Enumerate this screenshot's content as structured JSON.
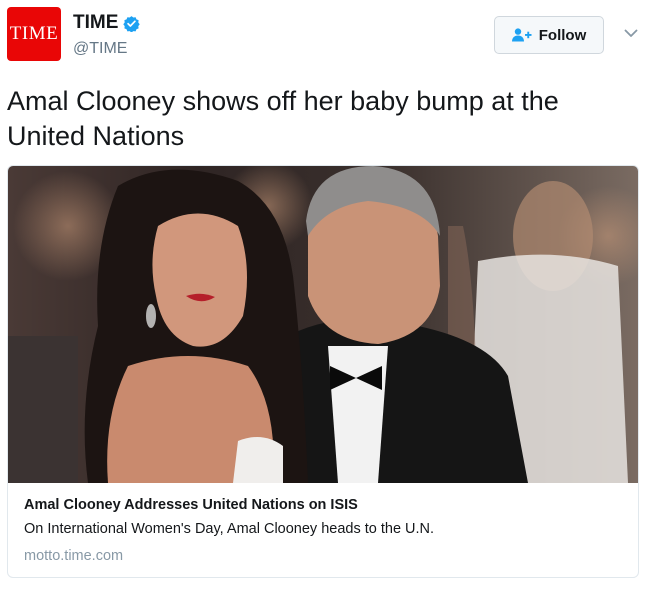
{
  "colors": {
    "brand": "#e90606",
    "verified": "#1da1f2",
    "follow_icon": "#1da1f2",
    "muted": "#657786",
    "card_border": "#e1e8ed"
  },
  "author": {
    "avatar_text": "TIME",
    "display_name": "TIME",
    "handle": "@TIME",
    "verified_icon": "verified-badge-icon"
  },
  "actions": {
    "follow_label": "Follow",
    "follow_icon": "add-user-icon",
    "more_icon": "chevron-down-icon"
  },
  "tweet": {
    "text": "Amal Clooney shows off her baby bump at the United Nations"
  },
  "card": {
    "image_icon": "photo",
    "title": "Amal Clooney Addresses United Nations on ISIS",
    "description": "On International Women's Day, Amal Clooney heads to the U.N.",
    "domain": "motto.time.com"
  }
}
